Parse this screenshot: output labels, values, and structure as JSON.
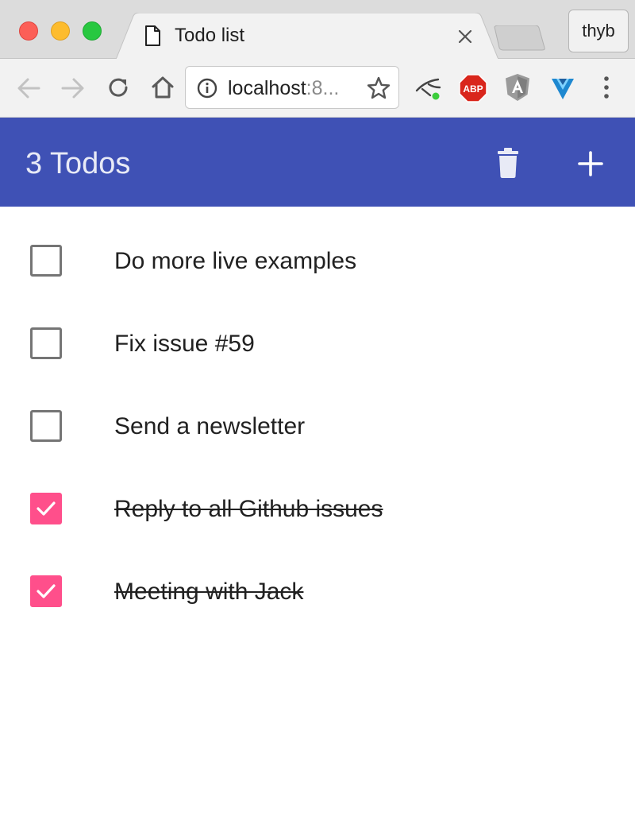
{
  "browser": {
    "tab": {
      "title": "Todo list",
      "icon": "document-icon"
    },
    "profile_label": "thyb",
    "address": {
      "host": "localhost",
      "rest": ":8..."
    },
    "extensions": [
      "wappalyzer-icon",
      "adblock-plus-icon",
      "angular-icon",
      "vue-devtools-icon"
    ]
  },
  "appbar": {
    "title": "3 Todos",
    "color": "#3f51b5"
  },
  "todos": [
    {
      "text": "Do more live examples",
      "done": false
    },
    {
      "text": "Fix issue #59",
      "done": false
    },
    {
      "text": "Send a newsletter",
      "done": false
    },
    {
      "text": "Reply to all Github issues",
      "done": true
    },
    {
      "text": "Meeting with Jack",
      "done": true
    }
  ],
  "colors": {
    "checkbox_checked": "#ff4f8b",
    "checkbox_unchecked": "#757575"
  }
}
